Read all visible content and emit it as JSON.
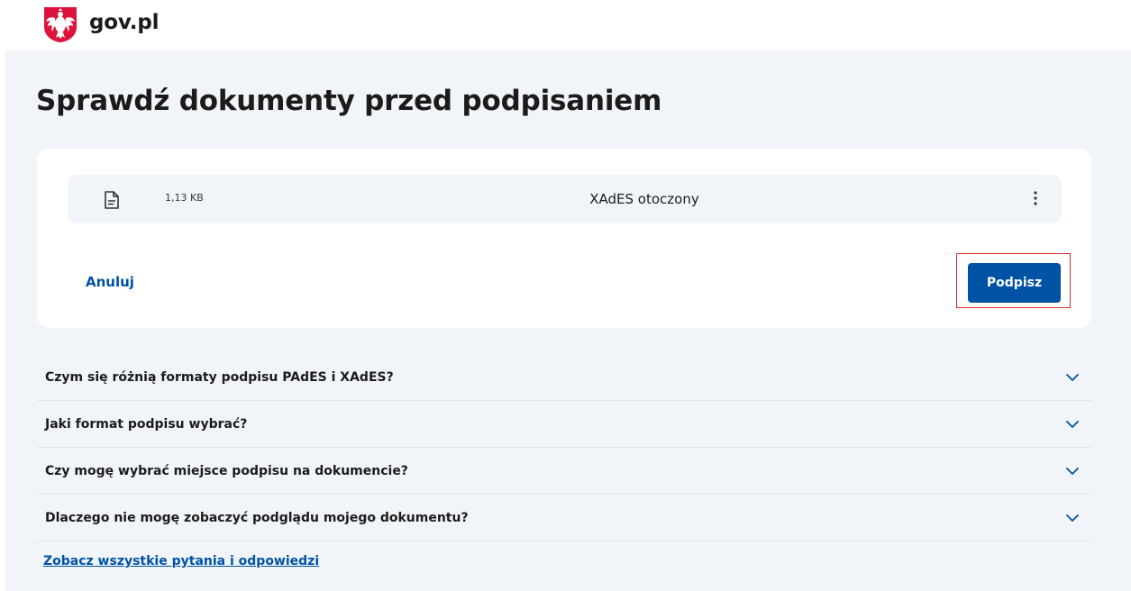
{
  "header": {
    "brand": "gov.pl",
    "emblem_icon": "polish-eagle-emblem"
  },
  "main": {
    "title": "Sprawdź dokumenty przed podpisaniem"
  },
  "document": {
    "icon": "document-icon",
    "size": "1,13 KB",
    "format": "XAdES otoczony",
    "more_icon": "more-vertical-icon"
  },
  "actions": {
    "cancel_label": "Anuluj",
    "sign_label": "Podpisz"
  },
  "faq": {
    "items": [
      {
        "question": "Czym się różnią formaty podpisu PAdES i XAdES?"
      },
      {
        "question": "Jaki format podpisu wybrać?"
      },
      {
        "question": "Czy mogę wybrać miejsce podpisu na dokumencie?"
      },
      {
        "question": "Dlaczego nie mogę zobaczyć podglądu mojego dokumentu?"
      }
    ],
    "all_link": "Zobacz wszystkie pytania i odpowiedzi"
  },
  "colors": {
    "accent": "#0052a5",
    "background": "#f1f5f9",
    "emblem_red": "#dc143c",
    "highlight": "#d32f2f"
  }
}
